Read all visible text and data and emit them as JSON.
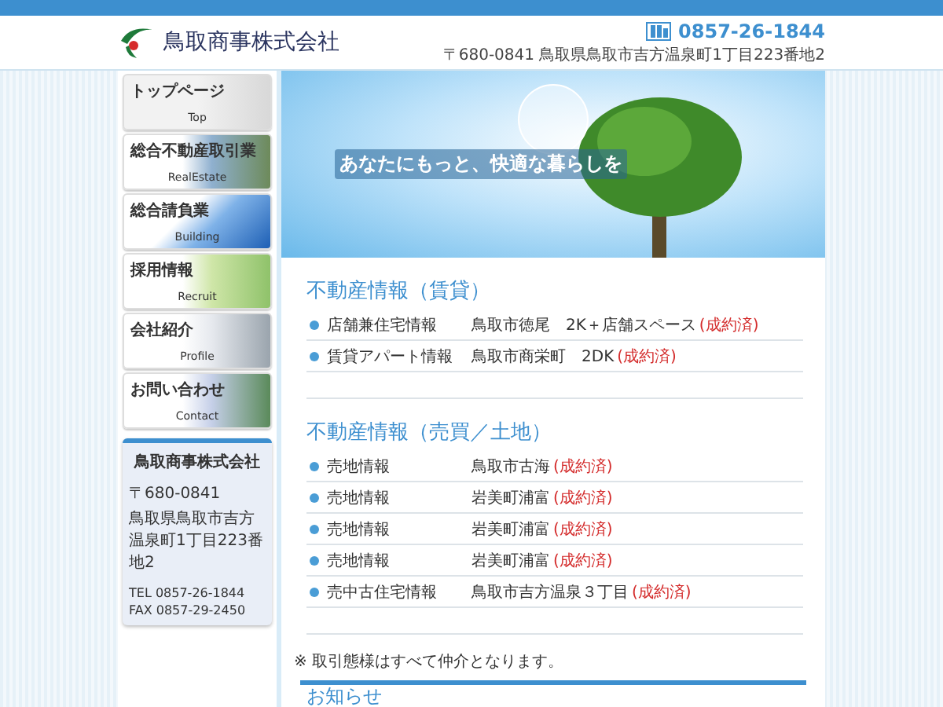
{
  "header": {
    "company": "鳥取商事株式会社",
    "phone": "0857-26-1844",
    "address": "〒680-0841 鳥取県鳥取市吉方温泉町1丁目223番地2"
  },
  "nav": [
    {
      "label": "トップページ",
      "sub": "Top"
    },
    {
      "label": "総合不動産取引業",
      "sub": "RealEstate"
    },
    {
      "label": "総合請負業",
      "sub": "Building"
    },
    {
      "label": "採用情報",
      "sub": "Recruit"
    },
    {
      "label": "会社紹介",
      "sub": "Profile"
    },
    {
      "label": "お問い合わせ",
      "sub": "Contact"
    }
  ],
  "info_card": {
    "name": "鳥取商事株式会社",
    "postal": "〒680-0841",
    "address": "鳥取県鳥取市吉方温泉町1丁目223番地2",
    "tel": "TEL 0857-26-1844",
    "fax": "FAX 0857-29-2450"
  },
  "hero": {
    "tagline": "あなたにもっと、快適な暮らしを"
  },
  "sections": [
    {
      "title": "不動産情報（賃貸）",
      "rows": [
        {
          "label": "店舗兼住宅情報",
          "value": "鳥取市徳尾　2K＋店舗スペース",
          "status": "(成約済)"
        },
        {
          "label": "賃貸アパート情報",
          "value": "鳥取市商栄町　2DK",
          "status": "(成約済)"
        }
      ]
    },
    {
      "title": "不動産情報（売買／土地）",
      "rows": [
        {
          "label": "売地情報",
          "value": "鳥取市古海",
          "status": "(成約済)"
        },
        {
          "label": "売地情報",
          "value": "岩美町浦富",
          "status": "(成約済)"
        },
        {
          "label": "売地情報",
          "value": "岩美町浦富",
          "status": "(成約済)"
        },
        {
          "label": "売地情報",
          "value": "岩美町浦富",
          "status": "(成約済)"
        },
        {
          "label": "売中古住宅情報",
          "value": "鳥取市吉方温泉３丁目",
          "status": "(成約済)"
        }
      ]
    }
  ],
  "note": "※ 取引態様はすべて仲介となります。",
  "news": {
    "title": "お知らせ"
  }
}
